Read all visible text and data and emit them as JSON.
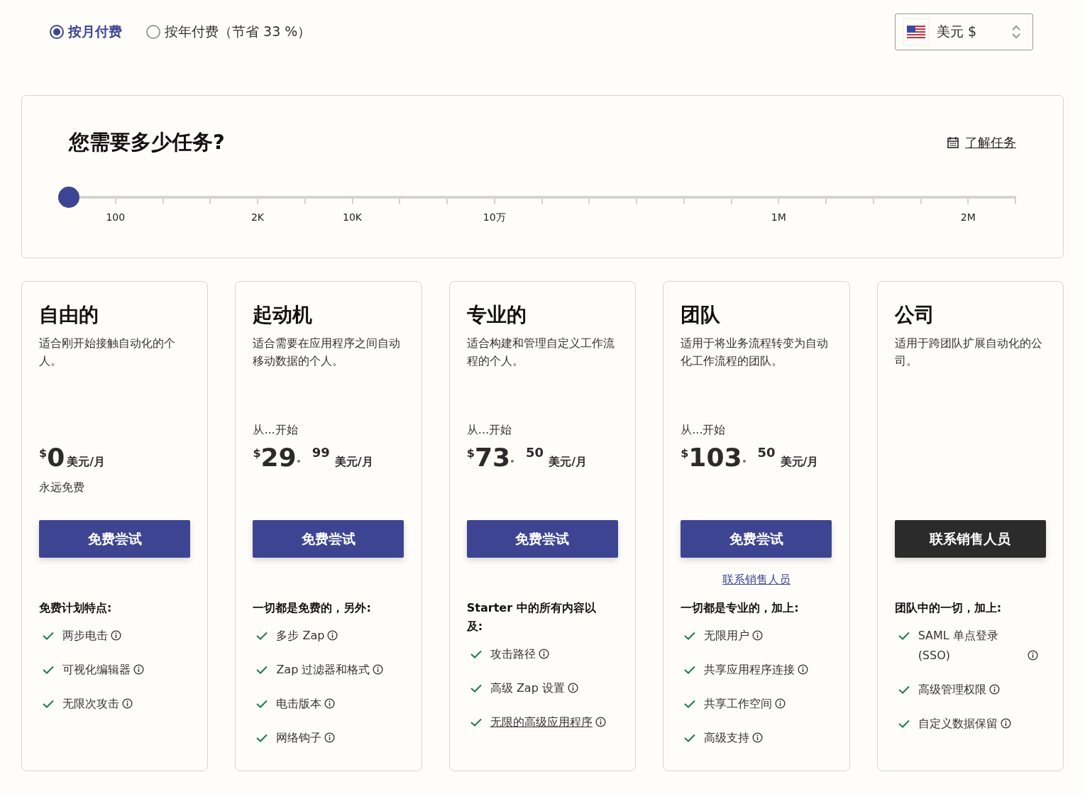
{
  "billing": {
    "options": [
      {
        "label": "按月付费",
        "selected": true
      },
      {
        "label": "按年付费（节省 33 %）",
        "selected": false
      }
    ]
  },
  "currency": {
    "value": "美元 $"
  },
  "tasks": {
    "title": "您需要多少任务?",
    "link": "了解任务",
    "slider": {
      "level": 0,
      "ticks": [
        {
          "kind": "major",
          "label": "100"
        },
        {
          "kind": "minor"
        },
        {
          "kind": "minor"
        },
        {
          "kind": "major",
          "label": "2K"
        },
        {
          "kind": "minor"
        },
        {
          "kind": "major",
          "label": "10K"
        },
        {
          "kind": "minor"
        },
        {
          "kind": "minor"
        },
        {
          "kind": "major",
          "label": "10万"
        },
        {
          "kind": "minor"
        },
        {
          "kind": "minor"
        },
        {
          "kind": "minor"
        },
        {
          "kind": "minor"
        },
        {
          "kind": "minor"
        },
        {
          "kind": "major",
          "label": "1M"
        },
        {
          "kind": "minor"
        },
        {
          "kind": "minor"
        },
        {
          "kind": "minor"
        },
        {
          "kind": "major",
          "label": "2M"
        },
        {
          "kind": "minor"
        }
      ]
    }
  },
  "plans": [
    {
      "name": "自由的",
      "description": "适合刚开始接触自动化的个人。",
      "price": {
        "currency": "$",
        "amount": "0",
        "unit": "美元/月"
      },
      "note": "永远免费",
      "button": {
        "label": "免费尝试",
        "kind": "primary"
      },
      "features_title": "免费计划特点:",
      "features": [
        {
          "text": "两步电击",
          "link": false
        },
        {
          "text": "可视化编辑器",
          "link": false
        },
        {
          "text": "无限次攻击",
          "link": false
        }
      ]
    },
    {
      "name": "起动机",
      "description": "适合需要在应用程序之间自动移动数据的个人。",
      "from": "从...开始",
      "price": {
        "currency": "$",
        "amount": "29",
        "separator": "。",
        "cents": "99",
        "unit": "美元/月"
      },
      "button": {
        "label": "免费尝试",
        "kind": "primary"
      },
      "features_title": "一切都是免费的，另外:",
      "features": [
        {
          "text": "多步 Zap",
          "link": false
        },
        {
          "text": "Zap 过滤器和格式",
          "link": false
        },
        {
          "text": "电击版本",
          "link": false
        },
        {
          "text": "网络钩子",
          "link": false
        }
      ]
    },
    {
      "name": "专业的",
      "description": "适合构建和管理自定义工作流程的个人。",
      "from": "从...开始",
      "price": {
        "currency": "$",
        "amount": "73",
        "separator": "。",
        "cents": "50",
        "unit": "美元/月"
      },
      "button": {
        "label": "免费尝试",
        "kind": "primary"
      },
      "features_title": "Starter 中的所有内容以及:",
      "features": [
        {
          "text": "攻击路径",
          "link": false
        },
        {
          "text": "高级 Zap 设置",
          "link": false
        },
        {
          "text": "无限的高级应用程序",
          "link": true
        }
      ]
    },
    {
      "name": "团队",
      "description": "适用于将业务流程转变为自动化工作流程的团队。",
      "from": "从...开始",
      "price": {
        "currency": "$",
        "amount": "103",
        "separator": "。",
        "cents": "50",
        "unit": "美元/月"
      },
      "button": {
        "label": "免费尝试",
        "kind": "primary"
      },
      "contact_link": "联系销售人员",
      "features_title": "一切都是专业的，加上:",
      "features": [
        {
          "text": "无限用户",
          "link": false
        },
        {
          "text": "共享应用程序连接",
          "link": false
        },
        {
          "text": "共享工作空间",
          "link": false
        },
        {
          "text": "高级支持",
          "link": false
        }
      ]
    },
    {
      "name": "公司",
      "description": "适用于跨团队扩展自动化的公司。",
      "button": {
        "label": "联系销售人员",
        "kind": "dark"
      },
      "features_title": "团队中的一切，加上:",
      "features": [
        {
          "text": "SAML 单点登录 (SSO)",
          "link": false
        },
        {
          "text": "高级管理权限",
          "link": false
        },
        {
          "text": "自定义数据保留",
          "link": false
        }
      ]
    }
  ]
}
